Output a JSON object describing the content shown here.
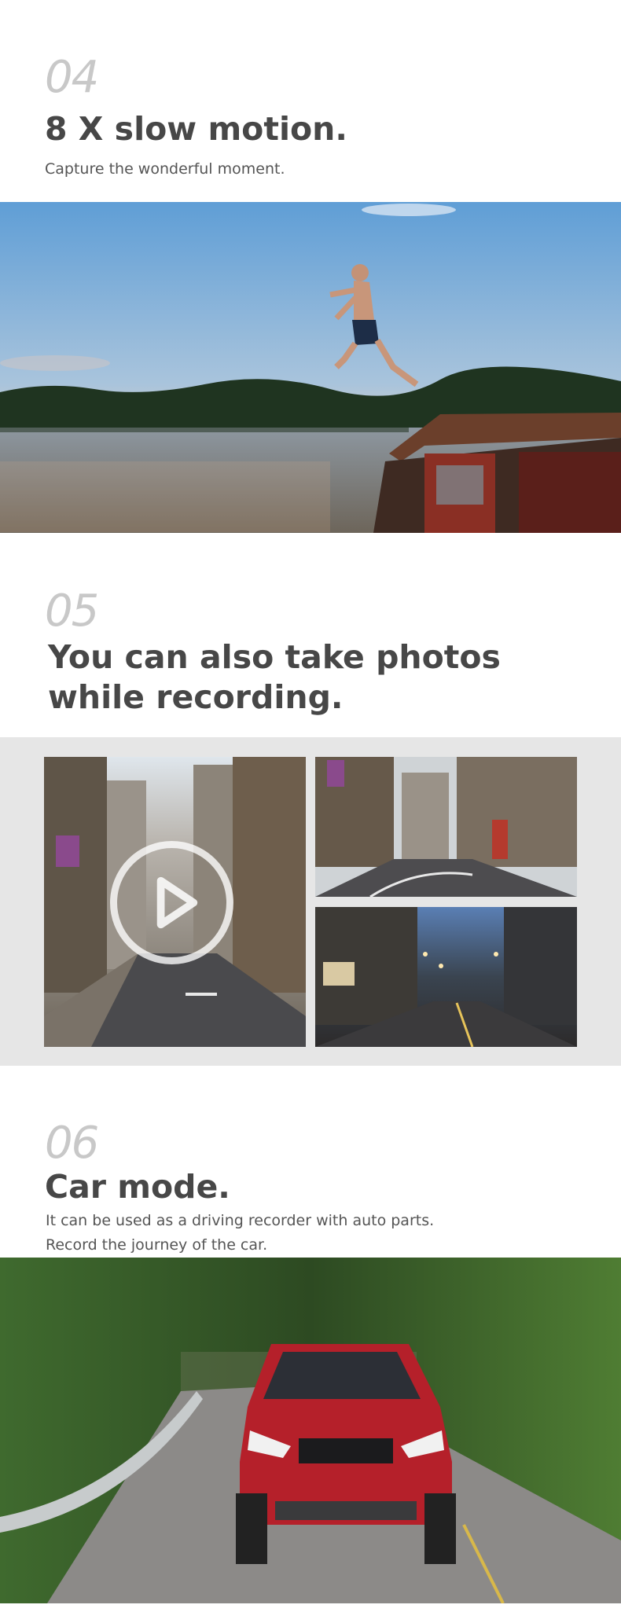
{
  "sections": [
    {
      "number": "04",
      "title": "8 X slow motion.",
      "subtitle": "Capture the wonderful moment.",
      "image": "jumping-man-boat-lake-photo"
    },
    {
      "number": "05",
      "title_line1": "You can also take photos",
      "title_line2": "while recording.",
      "images": [
        "city-street-video-photo",
        "city-street-day-photo",
        "city-street-dusk-photo"
      ],
      "play_icon": "play-icon"
    },
    {
      "number": "06",
      "title": "Car mode.",
      "subtitle_line1": "It can be used as a driving recorder with auto parts.",
      "subtitle_line2": "Record the journey of the car.",
      "image": "red-suv-road-photo"
    }
  ]
}
